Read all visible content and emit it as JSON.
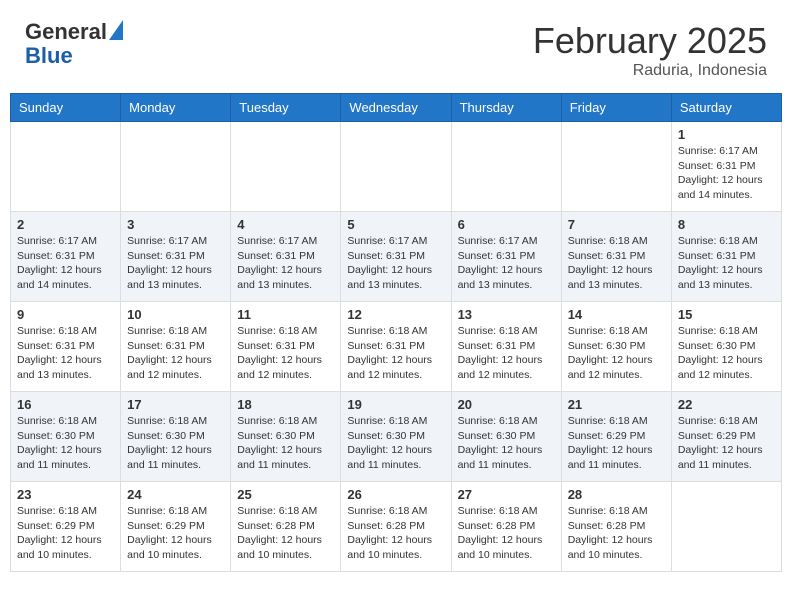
{
  "header": {
    "logo_general": "General",
    "logo_blue": "Blue",
    "month_title": "February 2025",
    "location": "Raduria, Indonesia"
  },
  "days_of_week": [
    "Sunday",
    "Monday",
    "Tuesday",
    "Wednesday",
    "Thursday",
    "Friday",
    "Saturday"
  ],
  "weeks": [
    [
      {
        "day": "",
        "info": ""
      },
      {
        "day": "",
        "info": ""
      },
      {
        "day": "",
        "info": ""
      },
      {
        "day": "",
        "info": ""
      },
      {
        "day": "",
        "info": ""
      },
      {
        "day": "",
        "info": ""
      },
      {
        "day": "1",
        "info": "Sunrise: 6:17 AM\nSunset: 6:31 PM\nDaylight: 12 hours\nand 14 minutes."
      }
    ],
    [
      {
        "day": "2",
        "info": "Sunrise: 6:17 AM\nSunset: 6:31 PM\nDaylight: 12 hours\nand 14 minutes."
      },
      {
        "day": "3",
        "info": "Sunrise: 6:17 AM\nSunset: 6:31 PM\nDaylight: 12 hours\nand 13 minutes."
      },
      {
        "day": "4",
        "info": "Sunrise: 6:17 AM\nSunset: 6:31 PM\nDaylight: 12 hours\nand 13 minutes."
      },
      {
        "day": "5",
        "info": "Sunrise: 6:17 AM\nSunset: 6:31 PM\nDaylight: 12 hours\nand 13 minutes."
      },
      {
        "day": "6",
        "info": "Sunrise: 6:17 AM\nSunset: 6:31 PM\nDaylight: 12 hours\nand 13 minutes."
      },
      {
        "day": "7",
        "info": "Sunrise: 6:18 AM\nSunset: 6:31 PM\nDaylight: 12 hours\nand 13 minutes."
      },
      {
        "day": "8",
        "info": "Sunrise: 6:18 AM\nSunset: 6:31 PM\nDaylight: 12 hours\nand 13 minutes."
      }
    ],
    [
      {
        "day": "9",
        "info": "Sunrise: 6:18 AM\nSunset: 6:31 PM\nDaylight: 12 hours\nand 13 minutes."
      },
      {
        "day": "10",
        "info": "Sunrise: 6:18 AM\nSunset: 6:31 PM\nDaylight: 12 hours\nand 12 minutes."
      },
      {
        "day": "11",
        "info": "Sunrise: 6:18 AM\nSunset: 6:31 PM\nDaylight: 12 hours\nand 12 minutes."
      },
      {
        "day": "12",
        "info": "Sunrise: 6:18 AM\nSunset: 6:31 PM\nDaylight: 12 hours\nand 12 minutes."
      },
      {
        "day": "13",
        "info": "Sunrise: 6:18 AM\nSunset: 6:31 PM\nDaylight: 12 hours\nand 12 minutes."
      },
      {
        "day": "14",
        "info": "Sunrise: 6:18 AM\nSunset: 6:30 PM\nDaylight: 12 hours\nand 12 minutes."
      },
      {
        "day": "15",
        "info": "Sunrise: 6:18 AM\nSunset: 6:30 PM\nDaylight: 12 hours\nand 12 minutes."
      }
    ],
    [
      {
        "day": "16",
        "info": "Sunrise: 6:18 AM\nSunset: 6:30 PM\nDaylight: 12 hours\nand 11 minutes."
      },
      {
        "day": "17",
        "info": "Sunrise: 6:18 AM\nSunset: 6:30 PM\nDaylight: 12 hours\nand 11 minutes."
      },
      {
        "day": "18",
        "info": "Sunrise: 6:18 AM\nSunset: 6:30 PM\nDaylight: 12 hours\nand 11 minutes."
      },
      {
        "day": "19",
        "info": "Sunrise: 6:18 AM\nSunset: 6:30 PM\nDaylight: 12 hours\nand 11 minutes."
      },
      {
        "day": "20",
        "info": "Sunrise: 6:18 AM\nSunset: 6:30 PM\nDaylight: 12 hours\nand 11 minutes."
      },
      {
        "day": "21",
        "info": "Sunrise: 6:18 AM\nSunset: 6:29 PM\nDaylight: 12 hours\nand 11 minutes."
      },
      {
        "day": "22",
        "info": "Sunrise: 6:18 AM\nSunset: 6:29 PM\nDaylight: 12 hours\nand 11 minutes."
      }
    ],
    [
      {
        "day": "23",
        "info": "Sunrise: 6:18 AM\nSunset: 6:29 PM\nDaylight: 12 hours\nand 10 minutes."
      },
      {
        "day": "24",
        "info": "Sunrise: 6:18 AM\nSunset: 6:29 PM\nDaylight: 12 hours\nand 10 minutes."
      },
      {
        "day": "25",
        "info": "Sunrise: 6:18 AM\nSunset: 6:28 PM\nDaylight: 12 hours\nand 10 minutes."
      },
      {
        "day": "26",
        "info": "Sunrise: 6:18 AM\nSunset: 6:28 PM\nDaylight: 12 hours\nand 10 minutes."
      },
      {
        "day": "27",
        "info": "Sunrise: 6:18 AM\nSunset: 6:28 PM\nDaylight: 12 hours\nand 10 minutes."
      },
      {
        "day": "28",
        "info": "Sunrise: 6:18 AM\nSunset: 6:28 PM\nDaylight: 12 hours\nand 10 minutes."
      },
      {
        "day": "",
        "info": ""
      }
    ]
  ]
}
